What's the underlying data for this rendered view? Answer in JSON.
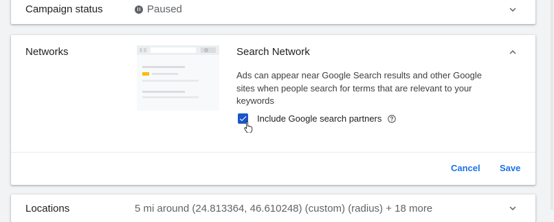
{
  "campaign_status": {
    "label": "Campaign status",
    "value": "Paused",
    "value_icon": "pause-circle-icon",
    "toggle_icon": "chevron-down-icon"
  },
  "networks": {
    "label": "Networks",
    "illustration": "search-results-illustration",
    "title": "Search Network",
    "toggle_icon": "chevron-up-icon",
    "description": "Ads can appear near Google Search results and other Google sites when people search for terms that are relevant to your keywords",
    "checkbox": {
      "label": "Include Google search partners",
      "checked": true,
      "help_icon": "help-circle-icon"
    },
    "actions": {
      "cancel": "Cancel",
      "save": "Save"
    }
  },
  "locations": {
    "label": "Locations",
    "value": "5 mi around (24.813364, 46.610248) (custom) (radius) + 18 more",
    "toggle_icon": "chevron-down-icon"
  },
  "colors": {
    "accent": "#1a73e8",
    "checkbox": "#1a56c8",
    "illustration_highlight": "#fbbc04",
    "background": "#f1f3f4"
  }
}
